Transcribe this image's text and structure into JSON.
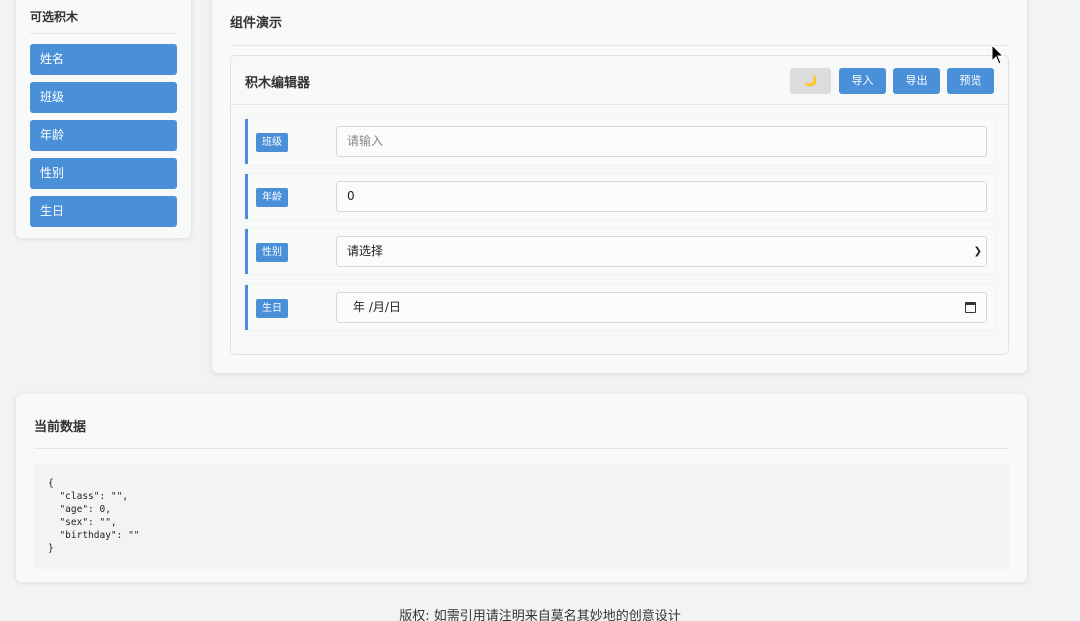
{
  "palette": {
    "title": "可选积木",
    "items": [
      "姓名",
      "班级",
      "年龄",
      "性别",
      "生日"
    ]
  },
  "demo": {
    "title": "组件演示",
    "editor": {
      "title": "积木编辑器",
      "theme_icon": "🌙",
      "import_label": "导入",
      "export_label": "导出",
      "preview_label": "预览",
      "rows": [
        {
          "label": "班级",
          "value": "",
          "placeholder": "请输入"
        },
        {
          "label": "年龄",
          "value": "0"
        },
        {
          "label": "性别",
          "value": "请选择"
        },
        {
          "label": "生日",
          "value": "年 /月/日"
        }
      ]
    }
  },
  "current": {
    "title": "当前数据",
    "json_text": "{\n  \"class\": \"\",\n  \"age\": 0,\n  \"sex\": \"\",\n  \"birthday\": \"\"\n}"
  },
  "footer": "版权: 如需引用请注明来自莫名其妙地的创意设计",
  "colors": {
    "accent": "#4a90d9",
    "background": "#f1f3f4"
  }
}
